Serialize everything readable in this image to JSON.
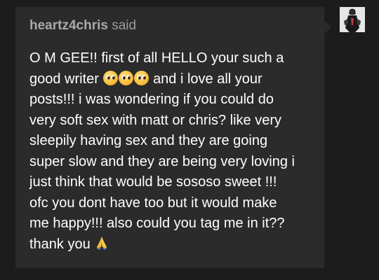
{
  "ask": {
    "asker_name": "heartz4chris",
    "said_label": "said",
    "lines": [
      "O M GEE!! first of all HELLO your such a",
      "good writer",
      "and i love all your",
      "posts!!! i was wondering if you could do",
      "very soft sex with matt or chris? like very",
      "sleepily having sex and they are going",
      "super slow and they are being very loving i",
      "just think that would be sososo sweet !!!",
      "ofc you dont have too but it would make",
      "me happy!!! also could you tag me in it??",
      "thank you"
    ],
    "emoji": {
      "pleading": "pleading-face-icon",
      "pray": "folded-hands-icon"
    }
  },
  "colors": {
    "background": "#1c1c1c",
    "card": "#2b2b2b",
    "text": "#ffffff",
    "asker": "#a9a9a9"
  }
}
